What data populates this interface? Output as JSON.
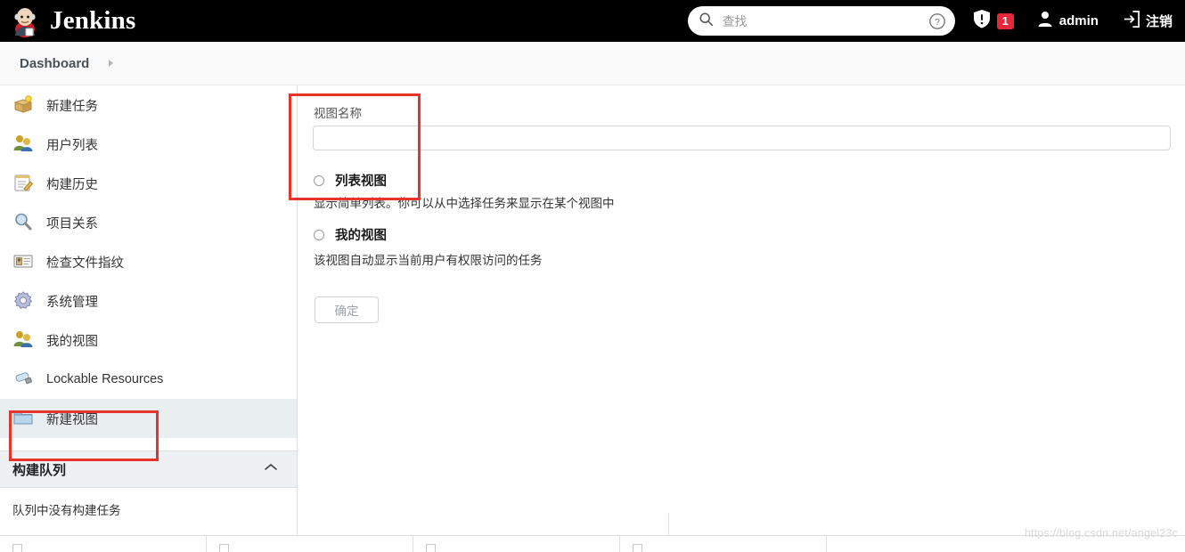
{
  "header": {
    "brand_title": "Jenkins",
    "logo_icon": "jenkins-butler-logo",
    "search": {
      "icon": "search-icon",
      "placeholder": "查找",
      "value": "",
      "help_icon": "help-circle-icon"
    },
    "security": {
      "icon": "shield-alert-icon",
      "badge_count": "1",
      "badge_color": "#e8273b"
    },
    "user": {
      "icon": "user-icon",
      "name": "admin"
    },
    "logout": {
      "icon": "logout-icon",
      "label": "注销"
    }
  },
  "breadcrumb": {
    "items": [
      "Dashboard"
    ],
    "arrow_icon": "chevron-right-icon"
  },
  "sidebar": {
    "items": [
      {
        "label": "新建任务",
        "icon": "new-job-box-icon",
        "selected": false
      },
      {
        "label": "用户列表",
        "icon": "people-icon",
        "selected": false
      },
      {
        "label": "构建历史",
        "icon": "notepad-pencil-icon",
        "selected": false
      },
      {
        "label": "项目关系",
        "icon": "magnifier-icon",
        "selected": false
      },
      {
        "label": "检查文件指纹",
        "icon": "id-card-icon",
        "selected": false
      },
      {
        "label": "系统管理",
        "icon": "gear-icon",
        "selected": false
      },
      {
        "label": "我的视图",
        "icon": "people-icon",
        "selected": false
      },
      {
        "label": "Lockable Resources",
        "icon": "usb-drive-icon",
        "selected": false
      },
      {
        "label": "新建视图",
        "icon": "folder-icon",
        "selected": true
      }
    ],
    "build_queue": {
      "title": "构建队列",
      "collapse_icon": "chevron-up-icon",
      "empty_text": "队列中没有构建任务"
    }
  },
  "main": {
    "name_field": {
      "label": "视图名称",
      "value": "",
      "placeholder": ""
    },
    "view_types": [
      {
        "label": "列表视图",
        "description": "显示简单列表。你可以从中选择任务来显示在某个视图中",
        "selected": false
      },
      {
        "label": "我的视图",
        "description": "该视图自动显示当前用户有权限访问的任务",
        "selected": false
      }
    ],
    "submit_button": {
      "label": "确定",
      "disabled": true
    }
  },
  "annotations": {
    "color": "#e8332a",
    "boxes": [
      {
        "name": "form-highlight"
      },
      {
        "name": "sidebar-new-view-highlight"
      }
    ]
  },
  "watermark": {
    "text": "https://blog.csdn.net/angel23c"
  }
}
